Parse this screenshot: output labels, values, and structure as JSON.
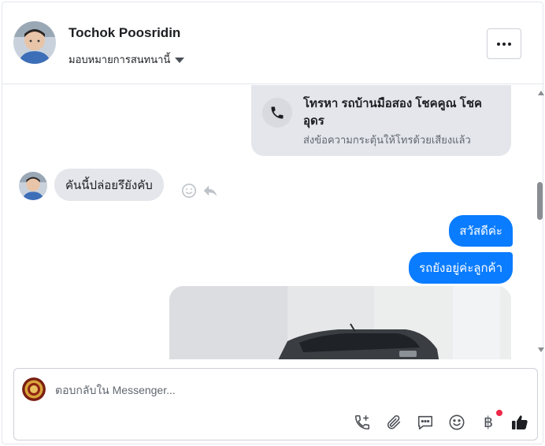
{
  "header": {
    "contact_name": "Tochok Poosridin",
    "assign_label": "มอบหมายการสนทนานี้"
  },
  "thread": {
    "call_card": {
      "title": "โทรหา รถบ้านมือสอง โชคคูณ โชคอุดร",
      "subtitle": "ส่งข้อความกระตุ้นให้โทรด้วยเสียงแล้ว"
    },
    "incoming": [
      {
        "text": "คันนี้ปล่อยรึยังคับ"
      }
    ],
    "outgoing": [
      {
        "text": "สวัสดีค่ะ"
      },
      {
        "text": "รถยังอยู่ค่ะลูกค้า"
      }
    ]
  },
  "composer": {
    "placeholder": "ตอบกลับใน Messenger...",
    "tools": [
      "call-add-icon",
      "paperclip-icon",
      "saved-reply-icon",
      "emoji-icon",
      "baht-payment-icon",
      "thumbs-up-icon"
    ],
    "baht_symbol": "฿"
  },
  "colors": {
    "outgoing_bubble": "#0a7cff",
    "incoming_bubble": "#e4e6eb",
    "notification_dot": "#f02849"
  }
}
